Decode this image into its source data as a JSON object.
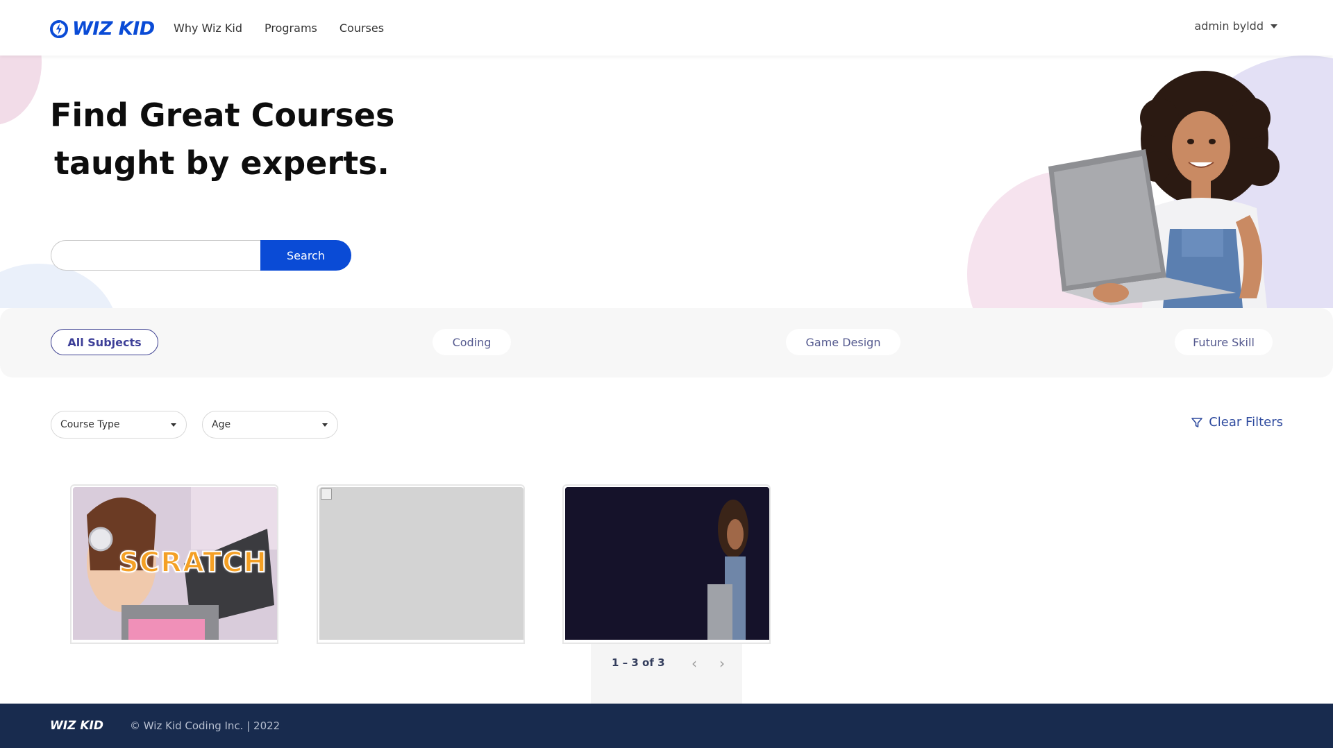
{
  "header": {
    "logo_text": "WIZ KID",
    "nav": [
      "Why Wiz Kid",
      "Programs",
      "Courses"
    ],
    "user_name": "admin byldd"
  },
  "hero": {
    "title_line1": "Find Great Courses",
    "title_line2": "taught by experts.",
    "search_placeholder": "",
    "search_button": "Search"
  },
  "subjects": {
    "all": "All Subjects",
    "coding": "Coding",
    "game_design": "Game Design",
    "future_skill": "Future Skill",
    "active": "All Subjects"
  },
  "filters": {
    "course_type": "Course Type",
    "age": "Age",
    "clear": "Clear Filters"
  },
  "cards": [
    {
      "image": "scratch-thumbnail",
      "overlay_text": "SCRATCH"
    },
    {
      "image": "broken-image"
    },
    {
      "image": "dark-thumbnail"
    }
  ],
  "pagination": {
    "label": "1 – 3 of 3"
  },
  "footer": {
    "logo_text": "WIZ KID",
    "copyright": "© Wiz Kid Coding Inc. | 2022"
  },
  "colors": {
    "brand_blue": "#0a4bd6",
    "footer_navy": "#182b4e",
    "chip_text": "#555a8f"
  }
}
